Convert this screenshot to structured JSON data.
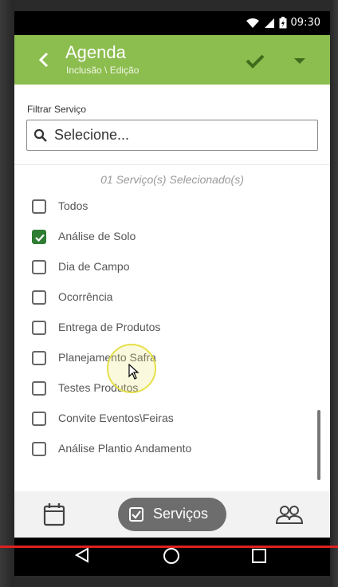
{
  "status_bar": {
    "time": "09:30"
  },
  "app_bar": {
    "title": "Agenda",
    "subtitle": "Inclusão \\ Edição",
    "color": "#8cbd4f"
  },
  "filter": {
    "label": "Filtrar Serviço",
    "search_value": "Selecione..."
  },
  "selected_count_text": "01 Serviço(s) Selecionado(s)",
  "services": [
    {
      "label": "Todos",
      "checked": false
    },
    {
      "label": "Análise de Solo",
      "checked": true
    },
    {
      "label": "Dia de Campo",
      "checked": false
    },
    {
      "label": "Ocorrência",
      "checked": false
    },
    {
      "label": "Entrega de Produtos",
      "checked": false
    },
    {
      "label": "Planejamento Safra",
      "checked": false
    },
    {
      "label": "Testes Produtos",
      "checked": false
    },
    {
      "label": "Convite Eventos\\Feiras",
      "checked": false
    },
    {
      "label": "Análise Plantio Andamento",
      "checked": false
    }
  ],
  "bottom_nav": {
    "active_label": "Serviços",
    "icons": [
      "calendar-icon",
      "checkbox-icon",
      "people-icon"
    ]
  },
  "android_nav": {
    "icons": [
      "back-icon",
      "home-icon",
      "recent-apps-icon"
    ]
  }
}
